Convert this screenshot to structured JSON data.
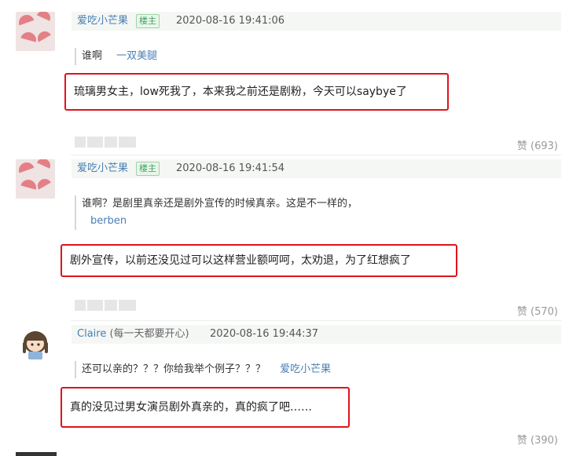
{
  "comments": [
    {
      "user": "爱吃小芒果",
      "badge": "楼主",
      "time": "2020-08-16 19:41:06",
      "quote_text": "谁啊",
      "quote_author": "一双美腿",
      "reply": "琉璃男女主，low死我了，本来我之前还是剧粉，今天可以saybye了",
      "likes": "赞 (693)"
    },
    {
      "user": "爱吃小芒果",
      "badge": "楼主",
      "time": "2020-08-16 19:41:54",
      "quote_text": "谁啊？是剧里真亲还是剧外宣传的时候真亲。这是不一样的，",
      "quote_author": "berben",
      "reply": "剧外宣传，以前还没见过可以这样营业额呵呵，太劝退，为了红想疯了",
      "likes": "赞 (570)"
    },
    {
      "user": "Claire",
      "user_note": "(每一天都要开心)",
      "time": "2020-08-16 19:44:37",
      "quote_text": "还可以亲的？？？你给我举个例子？？？",
      "quote_author": "爱吃小芒果",
      "reply": "真的没见过男女演员剧外真亲的，真的疯了吧……",
      "likes": "赞 (390)"
    }
  ],
  "colors": {
    "username": "#4a7fb3",
    "highlight_border": "#e0131b",
    "header_bg": "#f4f7f4",
    "badge_green": "#3fa05f"
  }
}
